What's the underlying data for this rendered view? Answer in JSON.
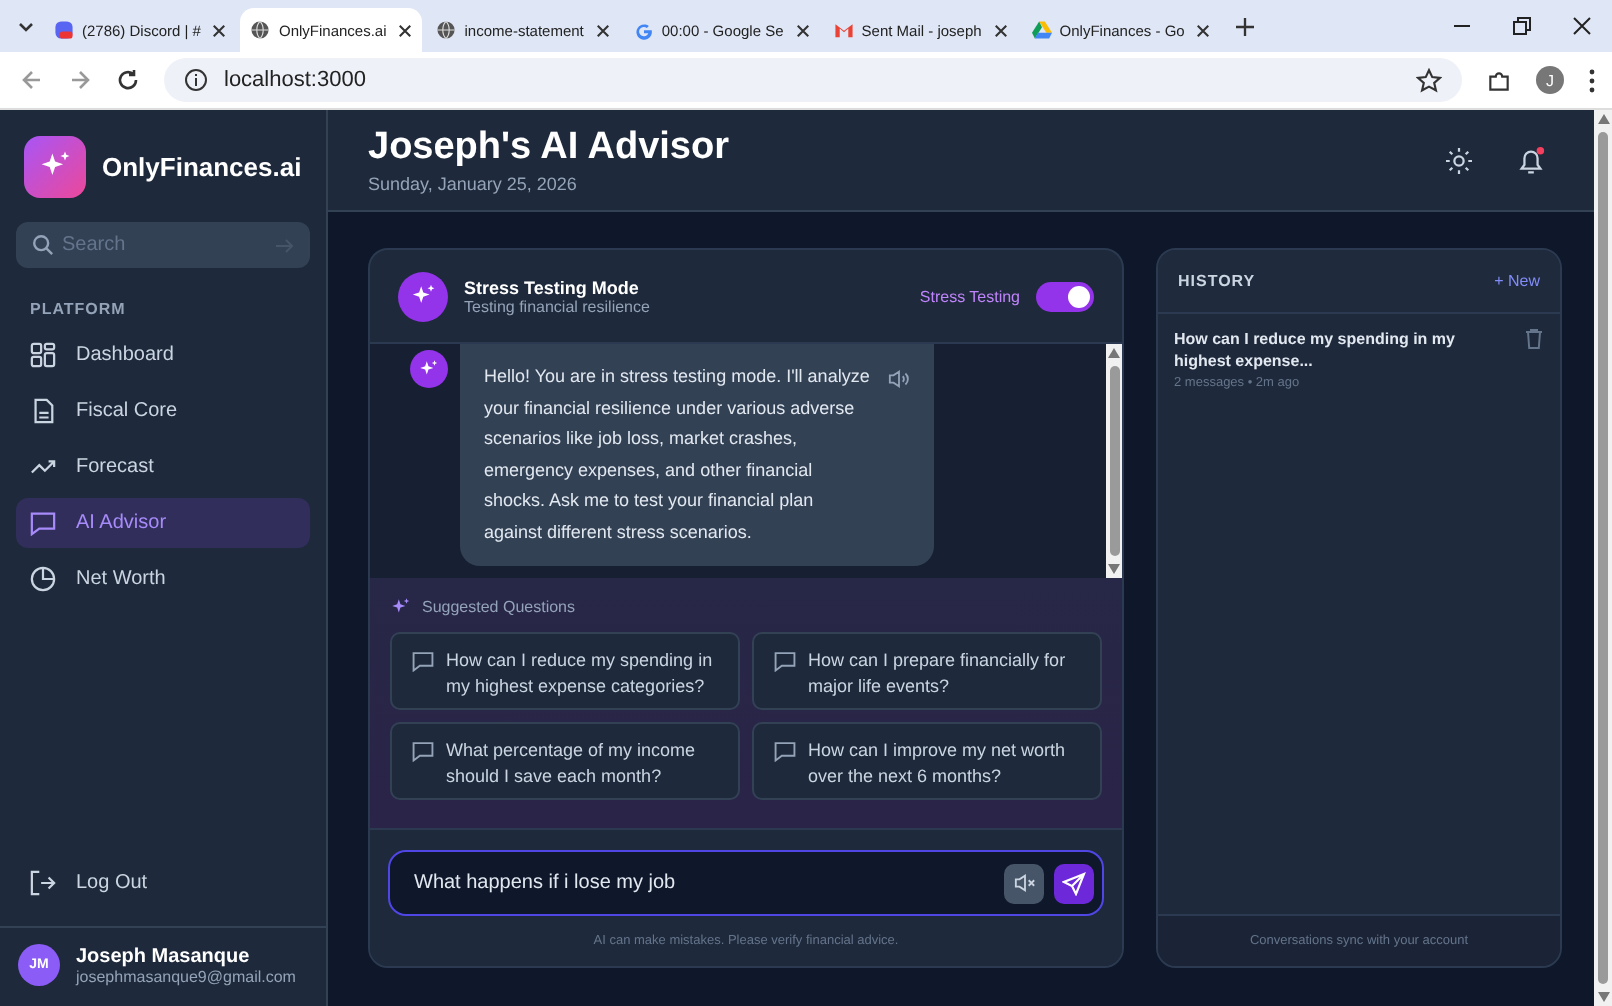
{
  "browser": {
    "tabs": [
      {
        "title": "(2786) Discord | #",
        "selected": false
      },
      {
        "title": "OnlyFinances.ai",
        "selected": true
      },
      {
        "title": "income-statement",
        "selected": false
      },
      {
        "title": "00:00 - Google Se",
        "selected": false
      },
      {
        "title": "Sent Mail - joseph",
        "selected": false
      },
      {
        "title": "OnlyFinances - Go",
        "selected": false
      }
    ],
    "address": "localhost:3000",
    "profile": "J"
  },
  "sidebar": {
    "brand": "OnlyFinances.ai",
    "search": {
      "placeholder": "Search"
    },
    "section": "PLATFORM",
    "items": [
      {
        "label": "Dashboard",
        "selected": false
      },
      {
        "label": "Fiscal Core",
        "selected": false
      },
      {
        "label": "Forecast",
        "selected": false
      },
      {
        "label": "AI Advisor",
        "selected": true
      },
      {
        "label": "Net Worth",
        "selected": false
      }
    ],
    "logout": "Log Out",
    "user": {
      "initials": "JM",
      "name": "Joseph Masanque",
      "email": "josephmasanque9@gmail.com"
    }
  },
  "header": {
    "title": "Joseph's AI Advisor",
    "date": "Sunday, January 25, 2026",
    "unread": true
  },
  "chat": {
    "mode": "Stress Testing Mode",
    "subtitle": "Testing financial resilience",
    "toggle_label": "Stress Testing",
    "toggle_on": true,
    "messages": [
      {
        "text": "Hello! You are in stress testing mode. I'll analyze your financial resilience under various adverse scenarios like job loss, market crashes, emergency expenses, and other financial shocks. Ask me to test your financial plan against different stress scenarios."
      }
    ],
    "suggested_title": "Suggested Questions",
    "questions": [
      "How can I reduce my spending in my highest expense categories?",
      "How can I prepare financially for major life events?",
      "What percentage of my income should I save each month?",
      "How can I improve my net worth over the next 6 months?"
    ],
    "input": {
      "value": "What happens if i lose my job"
    },
    "disclaimer": "AI can make mistakes. Please verify financial advice."
  },
  "history": {
    "title": "HISTORY",
    "new": "+ New",
    "items": [
      {
        "title": "How can I reduce my spending in my highest expense...",
        "meta": "2 messages • 2m ago"
      }
    ],
    "footer": "Conversations sync with your account"
  }
}
